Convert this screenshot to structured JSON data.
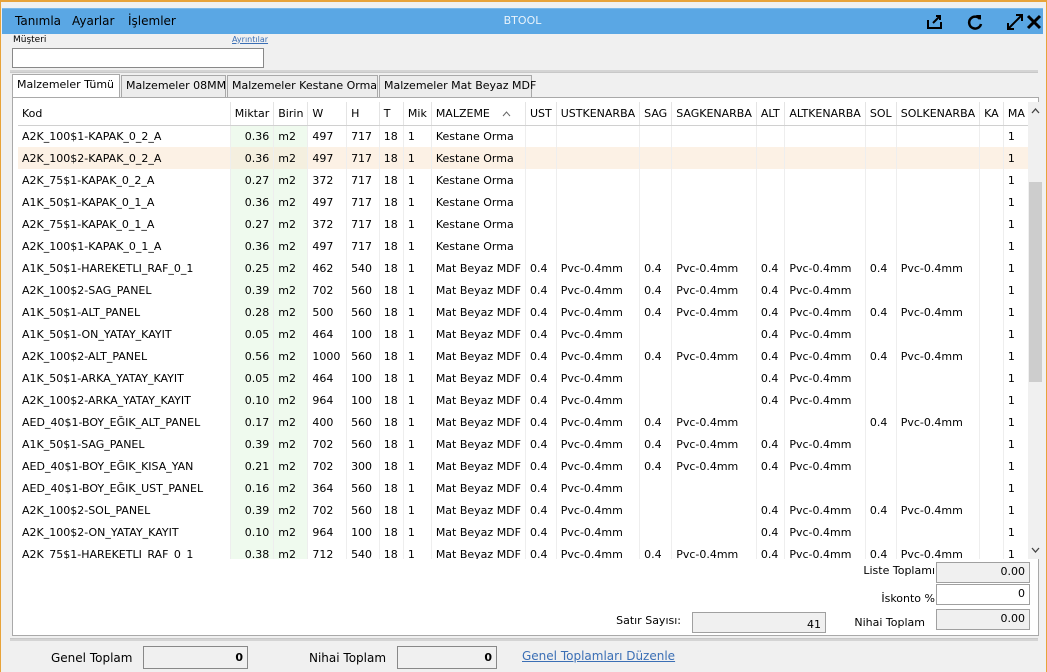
{
  "titlebar": {
    "menus": [
      "Tanımla",
      "Ayarlar",
      "İşlemler"
    ],
    "title": "BTOOL",
    "icons": [
      "export-icon",
      "refresh-icon",
      "expand-icon",
      "close-icon"
    ]
  },
  "customer": {
    "label": "Müşteri",
    "details_link": "Ayrıntılar",
    "value": ""
  },
  "tabs": [
    "Malzemeler Tümü",
    "Malzemeler 08MM",
    "Malzemeler Kestane Orma",
    "Malzemeler Mat Beyaz MDF"
  ],
  "grid": {
    "columns": [
      "Kod",
      "Miktar",
      "Birin",
      "W",
      "H",
      "T",
      "Mik",
      "MALZEME",
      "UST",
      "USTKENARBA",
      "SAG",
      "SAGKENARBA",
      "ALT",
      "ALTKENARBA",
      "SOL",
      "SOLKENARBA",
      "KA",
      "MA"
    ],
    "rows": [
      [
        "A2K_100$1-KAPAK_0_2_A",
        "0.36",
        "m2",
        "497",
        "717",
        "18",
        "1",
        "Kestane Orma",
        "",
        "",
        "",
        "",
        "",
        "",
        "",
        "",
        "",
        "1"
      ],
      [
        "A2K_100$2-KAPAK_0_2_A",
        "0.36",
        "m2",
        "497",
        "717",
        "18",
        "1",
        "Kestane Orma",
        "",
        "",
        "",
        "",
        "",
        "",
        "",
        "",
        "",
        "1"
      ],
      [
        "A2K_75$1-KAPAK_0_2_A",
        "0.27",
        "m2",
        "372",
        "717",
        "18",
        "1",
        "Kestane Orma",
        "",
        "",
        "",
        "",
        "",
        "",
        "",
        "",
        "",
        "1"
      ],
      [
        "A1K_50$1-KAPAK_0_1_A",
        "0.36",
        "m2",
        "497",
        "717",
        "18",
        "1",
        "Kestane Orma",
        "",
        "",
        "",
        "",
        "",
        "",
        "",
        "",
        "",
        "1"
      ],
      [
        "A2K_75$1-KAPAK_0_1_A",
        "0.27",
        "m2",
        "372",
        "717",
        "18",
        "1",
        "Kestane Orma",
        "",
        "",
        "",
        "",
        "",
        "",
        "",
        "",
        "",
        "1"
      ],
      [
        "A2K_100$1-KAPAK_0_1_A",
        "0.36",
        "m2",
        "497",
        "717",
        "18",
        "1",
        "Kestane Orma",
        "",
        "",
        "",
        "",
        "",
        "",
        "",
        "",
        "",
        "1"
      ],
      [
        "A1K_50$1-HAREKETLI_RAF_0_1",
        "0.25",
        "m2",
        "462",
        "540",
        "18",
        "1",
        "Mat Beyaz MDF",
        "0.4",
        "Pvc-0.4mm",
        "0.4",
        "Pvc-0.4mm",
        "0.4",
        "Pvc-0.4mm",
        "0.4",
        "Pvc-0.4mm",
        "",
        "1"
      ],
      [
        "A2K_100$2-SAG_PANEL",
        "0.39",
        "m2",
        "702",
        "560",
        "18",
        "1",
        "Mat Beyaz MDF",
        "0.4",
        "Pvc-0.4mm",
        "0.4",
        "Pvc-0.4mm",
        "0.4",
        "Pvc-0.4mm",
        "",
        "",
        "",
        "1"
      ],
      [
        "A1K_50$1-ALT_PANEL",
        "0.28",
        "m2",
        "500",
        "560",
        "18",
        "1",
        "Mat Beyaz MDF",
        "0.4",
        "Pvc-0.4mm",
        "0.4",
        "Pvc-0.4mm",
        "0.4",
        "Pvc-0.4mm",
        "0.4",
        "Pvc-0.4mm",
        "",
        "1"
      ],
      [
        "A1K_50$1-ON_YATAY_KAYIT",
        "0.05",
        "m2",
        "464",
        "100",
        "18",
        "1",
        "Mat Beyaz MDF",
        "0.4",
        "Pvc-0.4mm",
        "",
        "",
        "0.4",
        "Pvc-0.4mm",
        "",
        "",
        "",
        "1"
      ],
      [
        "A2K_100$2-ALT_PANEL",
        "0.56",
        "m2",
        "1000",
        "560",
        "18",
        "1",
        "Mat Beyaz MDF",
        "0.4",
        "Pvc-0.4mm",
        "0.4",
        "Pvc-0.4mm",
        "0.4",
        "Pvc-0.4mm",
        "0.4",
        "Pvc-0.4mm",
        "",
        "1"
      ],
      [
        "A1K_50$1-ARKA_YATAY_KAYIT",
        "0.05",
        "m2",
        "464",
        "100",
        "18",
        "1",
        "Mat Beyaz MDF",
        "0.4",
        "Pvc-0.4mm",
        "",
        "",
        "0.4",
        "Pvc-0.4mm",
        "",
        "",
        "",
        "1"
      ],
      [
        "A2K_100$2-ARKA_YATAY_KAYIT",
        "0.10",
        "m2",
        "964",
        "100",
        "18",
        "1",
        "Mat Beyaz MDF",
        "0.4",
        "Pvc-0.4mm",
        "",
        "",
        "0.4",
        "Pvc-0.4mm",
        "",
        "",
        "",
        "1"
      ],
      [
        "AED_40$1-BOY_EĞIK_ALT_PANEL",
        "0.17",
        "m2",
        "400",
        "560",
        "18",
        "1",
        "Mat Beyaz MDF",
        "0.4",
        "Pvc-0.4mm",
        "0.4",
        "Pvc-0.4mm",
        "",
        "",
        "0.4",
        "Pvc-0.4mm",
        "",
        "1"
      ],
      [
        "A1K_50$1-SAG_PANEL",
        "0.39",
        "m2",
        "702",
        "560",
        "18",
        "1",
        "Mat Beyaz MDF",
        "0.4",
        "Pvc-0.4mm",
        "0.4",
        "Pvc-0.4mm",
        "0.4",
        "Pvc-0.4mm",
        "",
        "",
        "",
        "1"
      ],
      [
        "AED_40$1-BOY_EĞIK_KISA_YAN",
        "0.21",
        "m2",
        "702",
        "300",
        "18",
        "1",
        "Mat Beyaz MDF",
        "0.4",
        "Pvc-0.4mm",
        "0.4",
        "Pvc-0.4mm",
        "0.4",
        "Pvc-0.4mm",
        "",
        "",
        "",
        "1"
      ],
      [
        "AED_40$1-BOY_EĞIK_UST_PANEL",
        "0.16",
        "m2",
        "364",
        "560",
        "18",
        "1",
        "Mat Beyaz MDF",
        "0.4",
        "Pvc-0.4mm",
        "",
        "",
        "",
        "",
        "",
        "",
        "",
        "1"
      ],
      [
        "A2K_100$2-SOL_PANEL",
        "0.39",
        "m2",
        "702",
        "560",
        "18",
        "1",
        "Mat Beyaz MDF",
        "0.4",
        "Pvc-0.4mm",
        "",
        "",
        "0.4",
        "Pvc-0.4mm",
        "0.4",
        "Pvc-0.4mm",
        "",
        "1"
      ],
      [
        "A2K_100$2-ON_YATAY_KAYIT",
        "0.10",
        "m2",
        "964",
        "100",
        "18",
        "1",
        "Mat Beyaz MDF",
        "0.4",
        "Pvc-0.4mm",
        "",
        "",
        "0.4",
        "Pvc-0.4mm",
        "",
        "",
        "",
        "1"
      ],
      [
        "A2K_75$1-HAREKETLI_RAF_0_1",
        "0.38",
        "m2",
        "712",
        "540",
        "18",
        "1",
        "Mat Beyaz MDF",
        "0.4",
        "Pvc-0.4mm",
        "0.4",
        "Pvc-0.4mm",
        "0.4",
        "Pvc-0.4mm",
        "0.4",
        "Pvc-0.4mm",
        "",
        "1"
      ]
    ],
    "selected_row": 1
  },
  "summary": {
    "liste_label": "Liste Toplamı",
    "liste_value": "0.00",
    "iskonto_label": "İskonto %",
    "iskonto_value": "0",
    "satir_label": "Satır Sayısı:",
    "satir_value": "41",
    "nihai_label": "Nihai Toplam",
    "nihai_value": "0.00"
  },
  "footer": {
    "genel_label": "Genel Toplam",
    "genel_value": "0",
    "nihai_label": "Nihai Toplam",
    "nihai_value": "0",
    "link": "Genel Toplamları Düzenle"
  },
  "colors": {
    "titlebar": "#5aa7e4",
    "border": "#e8a33a",
    "selected_row": "#fcf1e5",
    "miktar_column": "#effaee",
    "link": "#3b6fb5"
  }
}
